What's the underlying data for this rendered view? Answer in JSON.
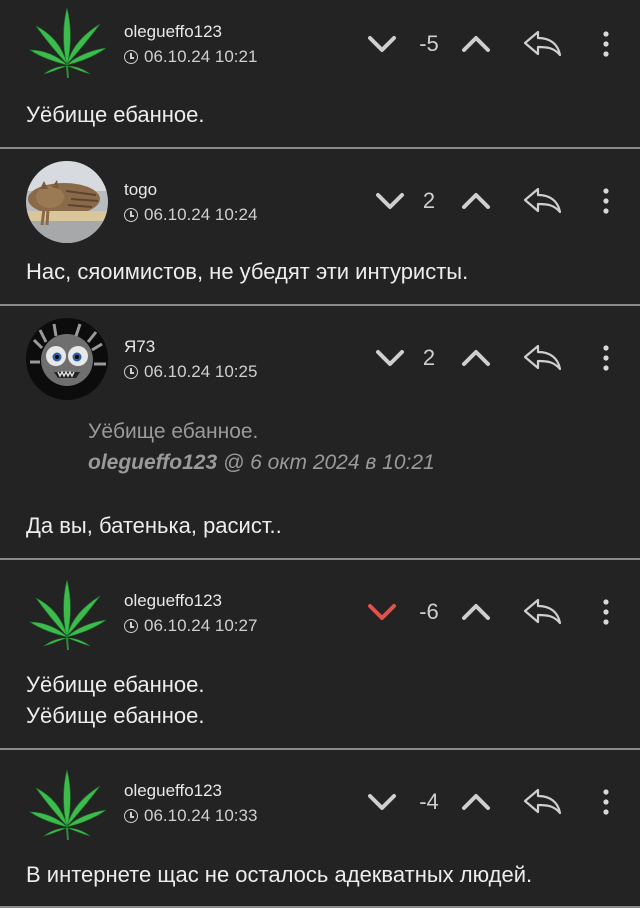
{
  "comments": [
    {
      "username": "olegueffo123",
      "datetime": "06.10.24 10:21",
      "score": "-5",
      "down_active": false,
      "avatar": "leaf",
      "lines": [
        "Уёбище ебанное."
      ]
    },
    {
      "username": "togo",
      "datetime": "06.10.24 10:24",
      "score": "2",
      "down_active": false,
      "avatar": "cat",
      "lines": [
        "Нас, сяоимистов, не убедят эти интуристы."
      ]
    },
    {
      "username": "Я73",
      "datetime": "06.10.24 10:25",
      "score": "2",
      "down_active": false,
      "avatar": "monster",
      "quote": {
        "text": "Уёбище ебанное.",
        "author": "olegueffo123",
        "date": "@ 6 окт 2024 в 10:21"
      },
      "lines": [
        "Да вы, батенька, расист.."
      ]
    },
    {
      "username": "olegueffo123",
      "datetime": "06.10.24 10:27",
      "score": "-6",
      "down_active": true,
      "avatar": "leaf",
      "lines": [
        "Уёбище ебанное.",
        "Уёбище ебанное."
      ]
    },
    {
      "username": "olegueffo123",
      "datetime": "06.10.24 10:33",
      "score": "-4",
      "down_active": false,
      "avatar": "leaf",
      "lines": [
        "В интернете щас не осталось адекватных людей."
      ]
    }
  ],
  "icons": {
    "vote_down": "chevron-down-icon",
    "vote_up": "chevron-up-icon",
    "reply": "reply-arrow-icon",
    "more": "more-vertical-icon",
    "time": "clock-icon"
  },
  "colors": {
    "background": "#232323",
    "divider": "#8a8a8a",
    "text": "#ededed",
    "muted": "#9a9a9a",
    "downvote_active": "#e0524d",
    "leaf": "#3bb24a"
  }
}
